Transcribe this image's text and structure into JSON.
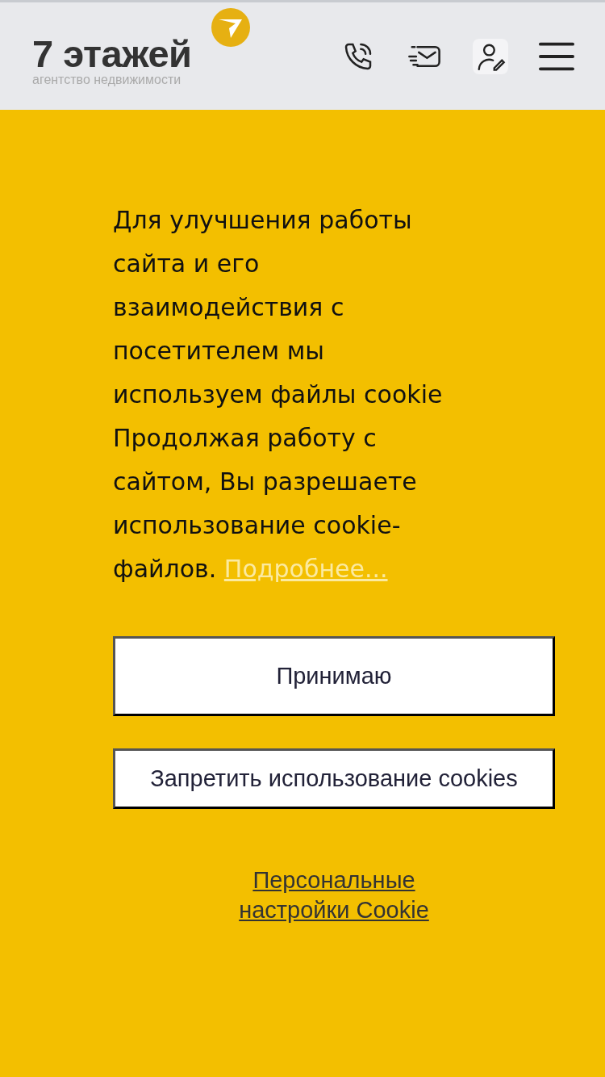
{
  "header": {
    "logo_title": "7 этажей",
    "logo_subtitle": "агентство недвижимости"
  },
  "cookie_notice": {
    "text": "Для улучшения работы сайта и его взаимодействия с посетителем мы используем файлы cookie Продолжая работу с сайтом, Вы разрешаете использование cookie-файлов.",
    "more_link": "Подробнее...",
    "buttons": [
      "Принимаю",
      "Запретить использование cookies"
    ],
    "settings_link": "Персональные настройки Cookie"
  }
}
